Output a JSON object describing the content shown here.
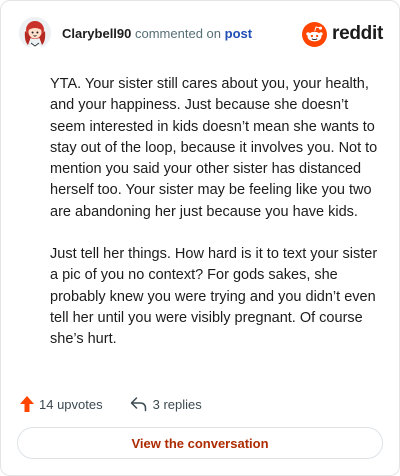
{
  "header": {
    "username": "Clarybell90",
    "action_text": "commented on",
    "link_text": "post",
    "brand": "reddit"
  },
  "comment": {
    "paragraphs": [
      "YTA. Your sister still cares about you, your health, and your happiness. Just because she doesn’t seem interested in kids doesn’t mean she wants to stay out of the loop, because it involves you. Not to mention you said your other sister has distanced herself too. Your sister may be feeling like you two are abandoning her just because you have kids.",
      "Just tell her things. How hard is it to text your sister a pic of you no context? For gods sakes, she probably knew you were trying and you didn’t even tell her until you were visibly pregnant. Of course she’s hurt."
    ]
  },
  "actions": {
    "upvotes": "14 upvotes",
    "replies": "3 replies"
  },
  "cta": {
    "label": "View the conversation"
  },
  "colors": {
    "upvote": "#ff4500",
    "link": "#1f4eb5",
    "cta_text": "#ad2b00",
    "brand": "#ff4500"
  },
  "icons": {
    "avatar": "avatar",
    "brand": "reddit-logo-icon",
    "upvote": "upvote-arrow-icon",
    "reply": "reply-arrow-icon"
  }
}
